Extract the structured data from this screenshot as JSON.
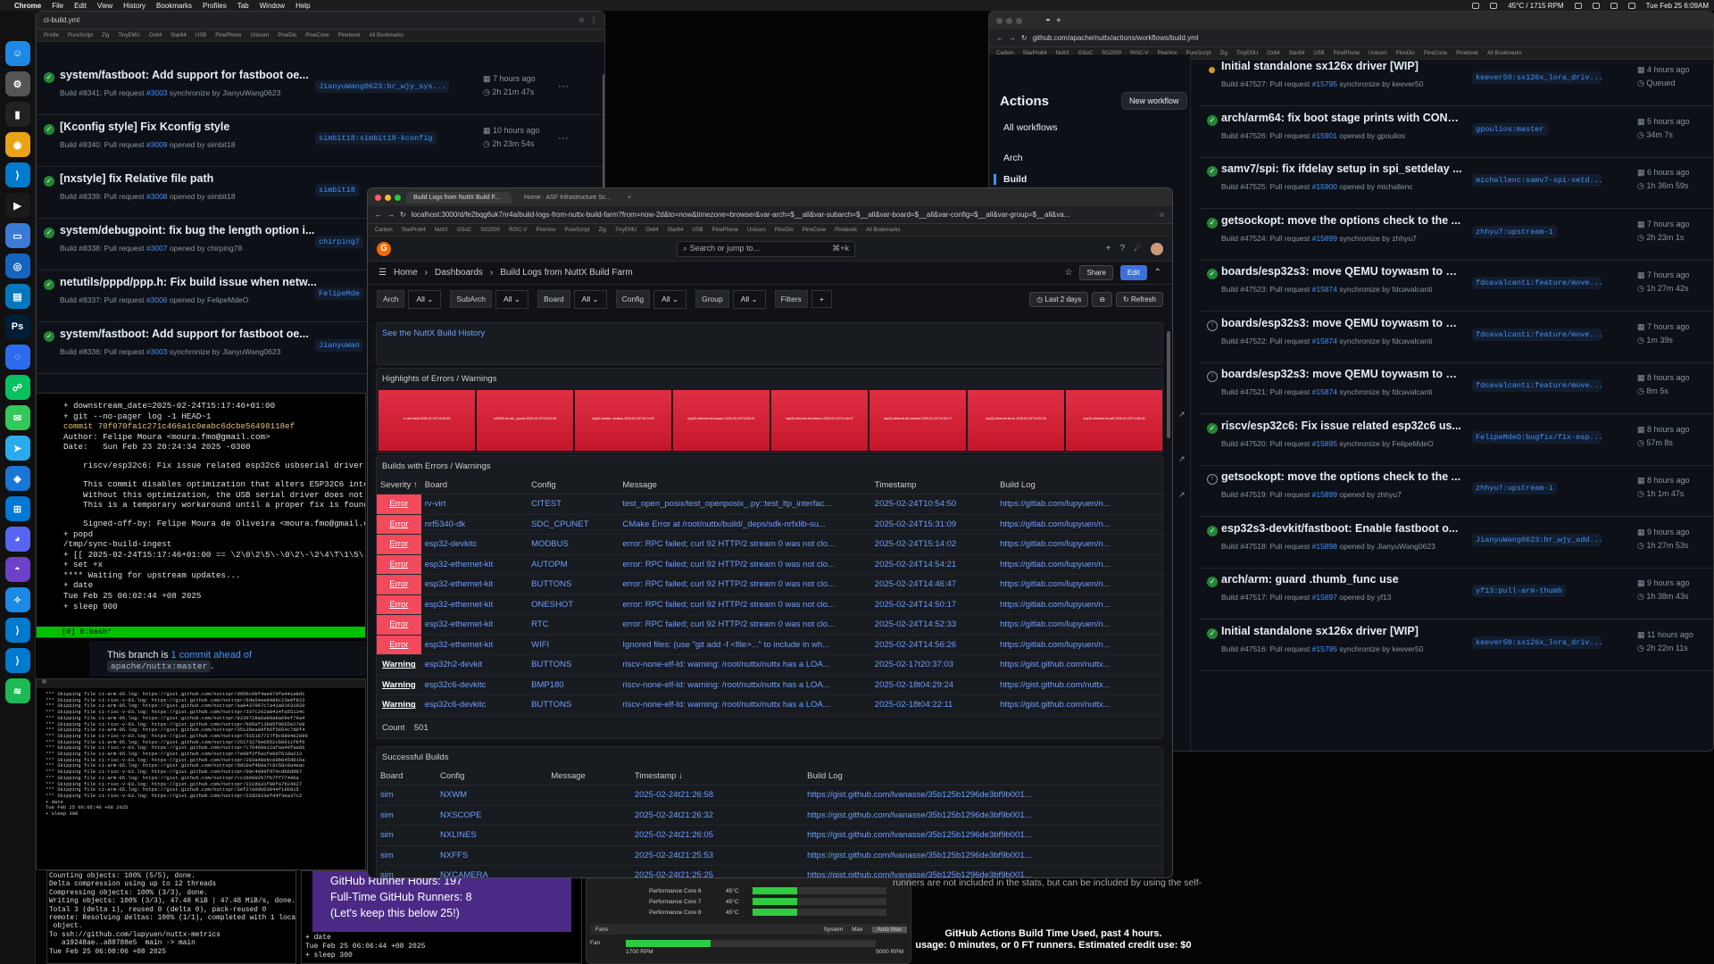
{
  "menubar": {
    "apple": "",
    "app": "Chrome",
    "items": [
      "File",
      "Edit",
      "View",
      "History",
      "Bookmarks",
      "Profiles",
      "Tab",
      "Window",
      "Help"
    ],
    "status": "45°C / 1715 RPM",
    "datetime": "Tue Feb 25 6:09AM"
  },
  "left_browser": {
    "url": "",
    "tab_hint": "ci-build.yml",
    "bookmarks": [
      "Prolite",
      "PureScript",
      "Zig",
      "TinyEMU",
      "Ox64",
      "Star64",
      "USB",
      "PinePhone",
      "Unicorn",
      "PineDio",
      "PineCone",
      "Pinebook",
      "All Bookmarks"
    ],
    "runs": [
      {
        "title": "system/fastboot: Add support for fastboot oe...",
        "sub1": "Build #8341: Pull request",
        "pr": "#3003",
        "sub2": "synchronize by JianyuWang0623",
        "branch": "JianyuWang0623:br_wjy_sys...",
        "ago": "7 hours ago",
        "dur": "2h 21m 47s"
      },
      {
        "title": "[Kconfig style] Fix Kconfig style",
        "sub1": "Build #8340: Pull request",
        "pr": "#3009",
        "sub2": "opened by simbit18",
        "branch": "simbit18:simbit18-kconfig",
        "ago": "10 hours ago",
        "dur": "2h 23m 54s"
      },
      {
        "title": "[nxstyle] fix Relative file path",
        "sub1": "Build #8339: Pull request",
        "pr": "#3008",
        "sub2": "opened by simbit18",
        "branch": "simbit18",
        "ago": "",
        "dur": ""
      },
      {
        "title": "system/debugpoint: fix bug the length option i...",
        "sub1": "Build #8338: Pull request",
        "pr": "#3007",
        "sub2": "opened by chirping78",
        "branch": "chirping7",
        "ago": "",
        "dur": ""
      },
      {
        "title": "netutils/pppd/ppp.h: Fix build issue when netw...",
        "sub1": "Build #8337: Pull request",
        "pr": "#3006",
        "sub2": "opened by FelipeMdeO",
        "branch": "FelipeMde",
        "ago": "",
        "dur": ""
      },
      {
        "title": "system/fastboot: Add support for fastboot oe...",
        "sub1": "Build #8336: Pull request",
        "pr": "#3003",
        "sub2": "synchronize by JianyuWang0623",
        "branch": "JianyuWan",
        "ago": "",
        "dur": ""
      }
    ]
  },
  "right_browser": {
    "url": "github.com/apache/nuttx/actions/workflows/build.yml",
    "bookmarks": [
      "Carbon",
      "StarPro64",
      "NuttX",
      "GSoC",
      "SG2000",
      "RISC-V",
      "PineVox",
      "PureScript",
      "Zig",
      "TinyEMU",
      "Ox64",
      "Star64",
      "USB",
      "PinePhone",
      "Unicorn",
      "PineDio",
      "PineCone",
      "Pinebook",
      "All Bookmarks"
    ],
    "sidebar": {
      "title": "Actions",
      "new_workflow": "New workflow",
      "all_workflows": "All workflows",
      "arch": "Arch",
      "build": "Build"
    },
    "runs": [
      {
        "status": "pending",
        "title": "Initial standalone sx126x driver [WIP]",
        "sub1": "Build #47527: Pull request",
        "pr": "#15795",
        "sub2": "synchronize by keever50",
        "branch": "keever50:sx126x_lora_driv...",
        "ago": "4 hours ago",
        "dur": "Queued"
      },
      {
        "status": "ok",
        "title": "arch/arm64: fix boot stage prints with CONF...",
        "sub1": "Build #47526: Pull request",
        "pr": "#15901",
        "sub2": "opened by gpoulios",
        "branch": "gpoulios:master",
        "ago": "5 hours ago",
        "dur": "34m 7s"
      },
      {
        "status": "ok",
        "title": "samv7/spi: fix ifdelay setup in spi_setdelay ...",
        "sub1": "Build #47525: Pull request",
        "pr": "#15900",
        "sub2": "opened by michallenc",
        "branch": "michallenc:samv7-spi-setd...",
        "ago": "6 hours ago",
        "dur": "1h 36m 59s"
      },
      {
        "status": "ok",
        "title": "getsockopt: move the options check to the ...",
        "sub1": "Build #47524: Pull request",
        "pr": "#15899",
        "sub2": "synchronize by zhhyu7",
        "branch": "zhhyu7:upstream-1",
        "ago": "7 hours ago",
        "dur": "2h 23m 1s"
      },
      {
        "status": "ok",
        "title": "boards/esp32s3: move QEMU toywasm to di...",
        "sub1": "Build #47523: Pull request",
        "pr": "#15874",
        "sub2": "synchronize by fdcavalcanti",
        "branch": "fdcavalcanti:feature/move...",
        "ago": "7 hours ago",
        "dur": "1h 27m 42s"
      },
      {
        "status": "skip",
        "title": "boards/esp32s3: move QEMU toywasm to di...",
        "sub1": "Build #47522: Pull request",
        "pr": "#15874",
        "sub2": "synchronize by fdcavalcanti",
        "branch": "fdcavalcanti:feature/move...",
        "ago": "7 hours ago",
        "dur": "1m 39s"
      },
      {
        "status": "skip",
        "title": "boards/esp32s3: move QEMU toywasm to di...",
        "sub1": "Build #47521: Pull request",
        "pr": "#15874",
        "sub2": "synchronize by fdcavalcanti",
        "branch": "fdcavalcanti:feature/move...",
        "ago": "8 hours ago",
        "dur": "8m 5s"
      },
      {
        "status": "ok",
        "title": "riscv/esp32c6: Fix issue related esp32c6 us...",
        "sub1": "Build #47520: Pull request",
        "pr": "#15895",
        "sub2": "synchronize by FelipeMdeO",
        "branch": "FelipeMdeO:bugfix/fix-esp...",
        "ago": "8 hours ago",
        "dur": "57m 8s"
      },
      {
        "status": "skip",
        "title": "getsockopt: move the options check to the ...",
        "sub1": "Build #47519: Pull request",
        "pr": "#15899",
        "sub2": "opened by zhhyu7",
        "branch": "zhhyu7:upstream-1",
        "ago": "8 hours ago",
        "dur": "1h 1m 47s"
      },
      {
        "status": "ok",
        "title": "esp32s3-devkit/fastboot: Enable fastboot o...",
        "sub1": "Build #47518: Pull request",
        "pr": "#15898",
        "sub2": "opened by JianyuWang0623",
        "branch": "JianyuWang0623:br_wjy_add...",
        "ago": "9 hours ago",
        "dur": "1h 27m 53s"
      },
      {
        "status": "ok",
        "title": "arch/arm: guard .thumb_func use",
        "sub1": "Build #47517: Pull request",
        "pr": "#15897",
        "sub2": "opened by yf13",
        "branch": "yf13:pull-arm-thumb",
        "ago": "9 hours ago",
        "dur": "1h 38m 43s"
      },
      {
        "status": "ok",
        "title": "Initial standalone sx126x driver [WIP]",
        "sub1": "Build #47516: Pull request",
        "pr": "#15795",
        "sub2": "synchronize by keever50",
        "branch": "keever50:sx126x_lora_driv...",
        "ago": "11 hours ago",
        "dur": "2h 22m 11s"
      }
    ]
  },
  "term_a": {
    "lines": [
      "+ downstream_date=2025-02-24T15:17:46+01:00",
      "+ git --no-pager log -1 HEAD~1",
      "commit 70f070fa1c271c466a1c0eabc6dcbe56498118ef",
      "Author: Felipe Moura <moura.fmo@gmail.com>",
      "Date:   Sun Feb 23 20:24:34 2025 -0300",
      "",
      "    riscv/esp32c6: Fix issue related esp32c6 usbserial driver.",
      "",
      "    This commit disables optimization that alters ESP32C6 inte",
      "    Without this optimization, the USB serial driver does not",
      "    This is a temporary workaround until a proper fix is found",
      "",
      "    Signed-off-by: Felipe Moura de Oliveira <moura.fmo@gmail.c",
      "+ popd",
      "/tmp/sync-build-ingest",
      "+ [[ 2025-02-24T15:17:46+01:00 == \\2\\0\\2\\5\\-\\0\\2\\-\\2\\4\\T\\1\\5\\:",
      "+ set +x",
      "**** Waiting for upstream updates...",
      "+ date",
      "Tue Feb 25 06:02:44 +08 2025",
      "+ sleep 900"
    ],
    "tmux": "[0] 0:bash*"
  },
  "branch_note": {
    "prefix": "This branch is",
    "link": "1 commit ahead of",
    "ref": "apache/nuttx:master",
    "suffix": "."
  },
  "term_b": {
    "lines": [
      "*** Skipping file ci-arm-05.log: https://gist.github.com/nuttxpr/d95bc8bf4ae970fa441a8d1",
      "*** Skipping file ci-risc-v-03.log: https://gist.github.com/nuttxpr/6da54ee8486c23e0f823",
      "*** Skipping file ci-arm-05.log: https://gist.github.com/nuttxpr/aa0437997c7a41a81631020",
      "*** Skipping file ci-risc-v-03.log: https://gist.github.com/nuttxpr/337c262a8414fa55134c",
      "*** Skipping file ci-arm-05.log: https://gist.github.com/nuttxpr/8239728a6a99aba69ef79a4",
      "*** Skipping file ci-risc-v-03.log: https://gist.github.com/nuttxpr/b95ef13b95f9655e27e9",
      "*** Skipping file ci-arm-05.log: https://gist.github.com/nuttxpr/35135ea00fb6f5654c7d8f4",
      "*** Skipping file ci-risc-v-03.log: https://gist.github.com/nuttxpr/515167727fbc880462890",
      "*** Skipping file ci-arm-05.log: https://gist.github.com/nuttxpr/25173276e0552cb8611fbf0",
      "*** Skipping file ci-risc-v-03.log: https://gist.github.com/nuttxpr/c76460e12afaa49faa66",
      "*** Skipping file ci-arm-05.log: https://gist.github.com/nuttxpr/7e09f2f6a1fe6d761da213",
      "*** Skipping file ci-risc-v-03.log: https://gist.github.com/nuttxpr/203a48ebce0b045d016a",
      "*** Skipping file ci-arm-05.log: https://gist.github.com/nuttxpr/dd10af4b0a7c9c58c8a4eac",
      "*** Skipping file ci-risc-v-03.log: https://gist.github.com/nuttxpr/09c4099fd74cdb6dd87",
      "*** Skipping file ci-arm-05.log: https://gist.github.com/nuttxpr/cc1b6002b7fb7ff77496a",
      "*** Skipping file ci-risc-v-03.log: https://gist.github.com/nuttxpr/222da31f90fa7b24627",
      "*** Skipping file ci-arm-05.log: https://gist.github.com/nuttxpr/3ef27e09b03044f16b915",
      "*** Skipping file ci-risc-v-03.log: https://gist.github.com/nuttxpr/22d2923efd4f3ea37c2",
      "+ date",
      "Tue Feb 25 06:05:40 +08 2025",
      "+ sleep 300"
    ]
  },
  "term_c": {
    "lines": [
      "Counting objects: 100% (5/5), done.",
      "Delta compression using up to 12 threads",
      "Compressing objects: 100% (3/3), done.",
      "Writing objects: 100% (3/3), 47.48 KiB | 47.48 MiB/s, done.",
      "Total 3 (delta 1), reused 0 (delta 0), pack-reused 0",
      "remote: Resolving deltas: 100% (1/1), completed with 1 local",
      " object.",
      "To ssh://github.com/lupyuen/nuttx-metrics",
      "   a19248ae..a88788e5  main -> main",
      "Tue Feb 25 06:08:06 +08 2025"
    ]
  },
  "term_d": {
    "box_lines": [
      "GitHub Runner Hours: 197",
      "Full-Time GitHub Runners: 8",
      "(Let's keep this below 25!)"
    ],
    "lines": [
      "+ date",
      "Tue Feb 25 06:06:44 +08 2025",
      "+ sleep 300"
    ]
  },
  "perf": {
    "rows": [
      {
        "label": "Performance Core 6",
        "temp": "45°C",
        "level": 0.33
      },
      {
        "label": "Performance Core 7",
        "temp": "45°C",
        "level": 0.33
      },
      {
        "label": "Performance Core 8",
        "temp": "45°C",
        "level": 0.33
      }
    ],
    "tabs": [
      "System",
      "Max",
      "Auto Max"
    ],
    "fans": "Fans",
    "fan": "Fan",
    "fan_rpm": "1700 RPM",
    "fan_max": "5000 RPM",
    "fan_level": 0.34
  },
  "billing": {
    "note": "kely not\nrunners are not included in the stats, but can be included by using the self-",
    "line1": "GitHub Actions Build Time Used, past 4 hours.",
    "line2": "usage: 0 minutes, or 0 FT runners. Estimated credit use: $0"
  },
  "grafana": {
    "tabs": [
      "Build Logs from NuttX Build F...",
      "Home · ASF Infrastructure Sc..."
    ],
    "url": "localhost:3000/d/fe2bqg6uk7nr4a/build-logs-from-nuttx-build-farm?from=now-2d&to=now&timezone=browser&var-arch=$__all&var-subarch=$__all&var-board=$__all&var-config=$__all&var-group=$__all&va...",
    "bookmarks": [
      "Carbon",
      "StarPro64",
      "NuttX",
      "GSoC",
      "SG2000",
      "RISC-V",
      "PineVox",
      "PureScript",
      "Zig",
      "TinyEMU",
      "Ox64",
      "Star64",
      "USB",
      "PinePhone",
      "Unicorn",
      "PineDio",
      "PineCone",
      "Pinebook",
      "All Bookmarks"
    ],
    "search": "Search or jump to...",
    "search_kbd": "⌘+k",
    "crumbs": [
      "Home",
      "Dashboards",
      "Build Logs from NuttX Build Farm"
    ],
    "share": "Share",
    "edit": "Edit",
    "vars": [
      {
        "label": "Arch",
        "value": "All"
      },
      {
        "label": "SubArch",
        "value": "All"
      },
      {
        "label": "Board",
        "value": "All"
      },
      {
        "label": "Config",
        "value": "All"
      },
      {
        "label": "Group",
        "value": "All"
      }
    ],
    "filters": "Filters",
    "time_range": "Last 2 days",
    "refresh": "Refresh",
    "history_link": "See the NuttX Build History",
    "highlights_title": "Highlights of Errors / Warnings",
    "tiles": [
      "rv-virt citest 2025-02-24T10:54:50",
      "nrf5340-dk sdc_cpunet 2025-02-24T15:31:09",
      "esp32-devkitc modbus 2025-02-24T15:14:02",
      "esp32-ethernet-kit autopm 2025-02-24T14:54:21",
      "esp32-ethernet-kit buttons 2025-02-24T14:46:47",
      "esp32-ethernet-kit oneshot 2025-02-24T14:50:17",
      "esp32-ethernet-kit rtc 2025-02-24T14:52:33",
      "esp32-ethernet-kit wifi 2025-02-24T14:56:26"
    ],
    "errors_title": "Builds with Errors / Warnings",
    "errors_cols": [
      "Severity ↑",
      "Board",
      "Config",
      "Message",
      "Timestamp",
      "Build Log"
    ],
    "errors_rows": [
      [
        "Error",
        "rv-virt",
        "CITEST",
        "test_open_posix/test_openposix_.py::test_ltp_interfac...",
        "2025-02-24T10:54:50",
        "https://gitlab.com/lupyuen/n..."
      ],
      [
        "Error",
        "nrf5340-dk",
        "SDC_CPUNET",
        "CMake Error at /root/nuttx/build/_deps/sdk-nrfxlib-su...",
        "2025-02-24T15:31:09",
        "https://gitlab.com/lupyuen/n..."
      ],
      [
        "Error",
        "esp32-devkitc",
        "MODBUS",
        "error: RPC failed; curl 92 HTTP/2 stream 0 was not clo...",
        "2025-02-24T15:14:02",
        "https://gitlab.com/lupyuen/n..."
      ],
      [
        "Error",
        "esp32-ethernet-kit",
        "AUTOPM",
        "error: RPC failed; curl 92 HTTP/2 stream 0 was not clo...",
        "2025-02-24T14:54:21",
        "https://gitlab.com/lupyuen/n..."
      ],
      [
        "Error",
        "esp32-ethernet-kit",
        "BUTTONS",
        "error: RPC failed; curl 92 HTTP/2 stream 0 was not clo...",
        "2025-02-24T14:46:47",
        "https://gitlab.com/lupyuen/n..."
      ],
      [
        "Error",
        "esp32-ethernet-kit",
        "ONESHOT",
        "error: RPC failed; curl 92 HTTP/2 stream 0 was not clo...",
        "2025-02-24T14:50:17",
        "https://gitlab.com/lupyuen/n..."
      ],
      [
        "Error",
        "esp32-ethernet-kit",
        "RTC",
        "error: RPC failed; curl 92 HTTP/2 stream 0 was not clo...",
        "2025-02-24T14:52:33",
        "https://gitlab.com/lupyuen/n..."
      ],
      [
        "Error",
        "esp32-ethernet-kit",
        "WIFI",
        "Ignored files: (use \"git add -f <file>...\" to include in wh...",
        "2025-02-24T14:56:26",
        "https://gitlab.com/lupyuen/n..."
      ],
      [
        "Warning",
        "esp32h2-devkit",
        "BUTTONS",
        "riscv-none-elf-ld: warning: /root/nuttx/nuttx has a LOA...",
        "2025-02-17t20:37:03",
        "https://gist.github.com/nuttx..."
      ],
      [
        "Warning",
        "esp32c6-devkitc",
        "BMP180",
        "riscv-none-elf-ld: warning: /root/nuttx/nuttx has a LOA...",
        "2025-02-18t04:29:24",
        "https://gist.github.com/nuttx..."
      ],
      [
        "Warning",
        "esp32c6-devkitc",
        "BUTTONS",
        "riscv-none-elf-ld: warning: /root/nuttx/nuttx has a LOA...",
        "2025-02-18t04:22:11",
        "https://gist.github.com/nuttx..."
      ]
    ],
    "count_label": "Count",
    "count_value": "501",
    "success_title": "Successful Builds",
    "success_cols": [
      "Board",
      "Config",
      "Message",
      "Timestamp ↓",
      "Build Log"
    ],
    "success_rows": [
      [
        "sim",
        "NXWM",
        "",
        "2025-02-24t21:26:58",
        "https://gist.github.com/lvanasse/35b125b1296de3bf9b001..."
      ],
      [
        "sim",
        "NXSCOPE",
        "",
        "2025-02-24t21:26:32",
        "https://gist.github.com/lvanasse/35b125b1296de3bf9b001..."
      ],
      [
        "sim",
        "NXLINES",
        "",
        "2025-02-24t21:26:05",
        "https://gist.github.com/lvanasse/35b125b1296de3bf9b001..."
      ],
      [
        "sim",
        "NXFFS",
        "",
        "2025-02-24t21:25:53",
        "https://gist.github.com/lvanasse/35b125b1296de3bf9b001..."
      ],
      [
        "sim",
        "NXCAMERA",
        "",
        "2025-02-24t21:25:25",
        "https://gist.github.com/lvanasse/35b125b1296de3bf9b001..."
      ]
    ]
  },
  "dock": {
    "apps": [
      {
        "icon": "finder-icon",
        "color": "#1e88e5",
        "glyph": "☺"
      },
      {
        "icon": "settings-icon",
        "color": "#555",
        "glyph": "⚙"
      },
      {
        "icon": "terminal-icon",
        "color": "#222",
        "glyph": "▮"
      },
      {
        "icon": "chrome-icon",
        "color": "#e8a317",
        "glyph": "◉"
      },
      {
        "icon": "vscode-icon",
        "color": "#007acc",
        "glyph": "⟩"
      },
      {
        "icon": "terminal-icon",
        "color": "#1a1a1a",
        "glyph": "▶"
      },
      {
        "icon": "simulator-icon",
        "color": "#3a7bd5",
        "glyph": "▭"
      },
      {
        "icon": "quicktime-icon",
        "color": "#1565c0",
        "glyph": "◎"
      },
      {
        "icon": "app-icon",
        "color": "#0277bd",
        "glyph": "▤"
      },
      {
        "icon": "photoshop-icon",
        "color": "#001e36",
        "glyph": "Ps"
      },
      {
        "icon": "signal-icon",
        "color": "#2c6bed",
        "glyph": "◌"
      },
      {
        "icon": "wechat-icon",
        "color": "#07c160",
        "glyph": "☍"
      },
      {
        "icon": "messages-icon",
        "color": "#34c759",
        "glyph": "✉"
      },
      {
        "icon": "telegram-icon",
        "color": "#2aabee",
        "glyph": "➤"
      },
      {
        "icon": "app-icon",
        "color": "#1976d2",
        "glyph": "◈"
      },
      {
        "icon": "windows-icon",
        "color": "#0078d4",
        "glyph": "⊞"
      },
      {
        "icon": "discord-icon",
        "color": "#5865f2",
        "glyph": "◕"
      },
      {
        "icon": "github-icon",
        "color": "#6e40c9",
        "glyph": "◓"
      },
      {
        "icon": "safari-icon",
        "color": "#1e88e5",
        "glyph": "✧"
      },
      {
        "icon": "vscode-icon",
        "color": "#007acc",
        "glyph": "⟩"
      },
      {
        "icon": "vscode-icon",
        "color": "#007acc",
        "glyph": "⟩"
      },
      {
        "icon": "spotify-icon",
        "color": "#1db954",
        "glyph": "≋"
      }
    ]
  }
}
